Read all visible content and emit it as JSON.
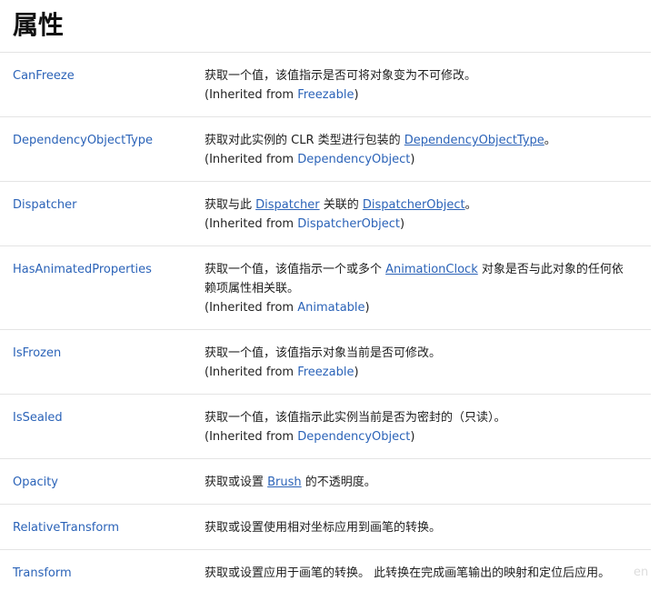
{
  "page": {
    "title": "属性"
  },
  "rows": [
    {
      "name": "CanFreeze",
      "desc1_before": "获取一个值，该值指示是否可将对象变为不可修改。",
      "inherited_prefix": "(Inherited from ",
      "inherited_link": "Freezable",
      "inherited_suffix": ")"
    },
    {
      "name": "DependencyObjectType",
      "desc1_before": "获取对此实例的 CLR 类型进行包装的 ",
      "desc1_link": "DependencyObjectType",
      "desc1_after": "。",
      "inherited_prefix": "(Inherited from ",
      "inherited_link": "DependencyObject",
      "inherited_suffix": ")"
    },
    {
      "name": "Dispatcher",
      "desc1_before": "获取与此 ",
      "desc1_link": "Dispatcher",
      "desc1_mid": " 关联的 ",
      "desc1_link2": "DispatcherObject",
      "desc1_after": "。",
      "inherited_prefix": "(Inherited from ",
      "inherited_link": "DispatcherObject",
      "inherited_suffix": ")"
    },
    {
      "name": "HasAnimatedProperties",
      "desc1_before": "获取一个值，该值指示一个或多个 ",
      "desc1_link": "AnimationClock",
      "desc1_after": " 对象是否与此对象的任何依",
      "desc2": "赖项属性相关联。",
      "inherited_prefix": "(Inherited from ",
      "inherited_link": "Animatable",
      "inherited_suffix": ")"
    },
    {
      "name": "IsFrozen",
      "desc1_before": "获取一个值，该值指示对象当前是否可修改。",
      "inherited_prefix": "(Inherited from ",
      "inherited_link": "Freezable",
      "inherited_suffix": ")"
    },
    {
      "name": "IsSealed",
      "desc1_before": "获取一个值，该值指示此实例当前是否为密封的（只读）。",
      "inherited_prefix": "(Inherited from ",
      "inherited_link": "DependencyObject",
      "inherited_suffix": ")"
    },
    {
      "name": "Opacity",
      "desc1_before": "获取或设置 ",
      "desc1_link": "Brush",
      "desc1_after": " 的不透明度。"
    },
    {
      "name": "RelativeTransform",
      "desc1_before": "获取或设置使用相对坐标应用到画笔的转换。"
    },
    {
      "name": "Transform",
      "desc1_before": "获取或设置应用于画笔的转换。 此转换在完成画笔输出的映射和定位后应用。"
    }
  ],
  "watermark": "en"
}
